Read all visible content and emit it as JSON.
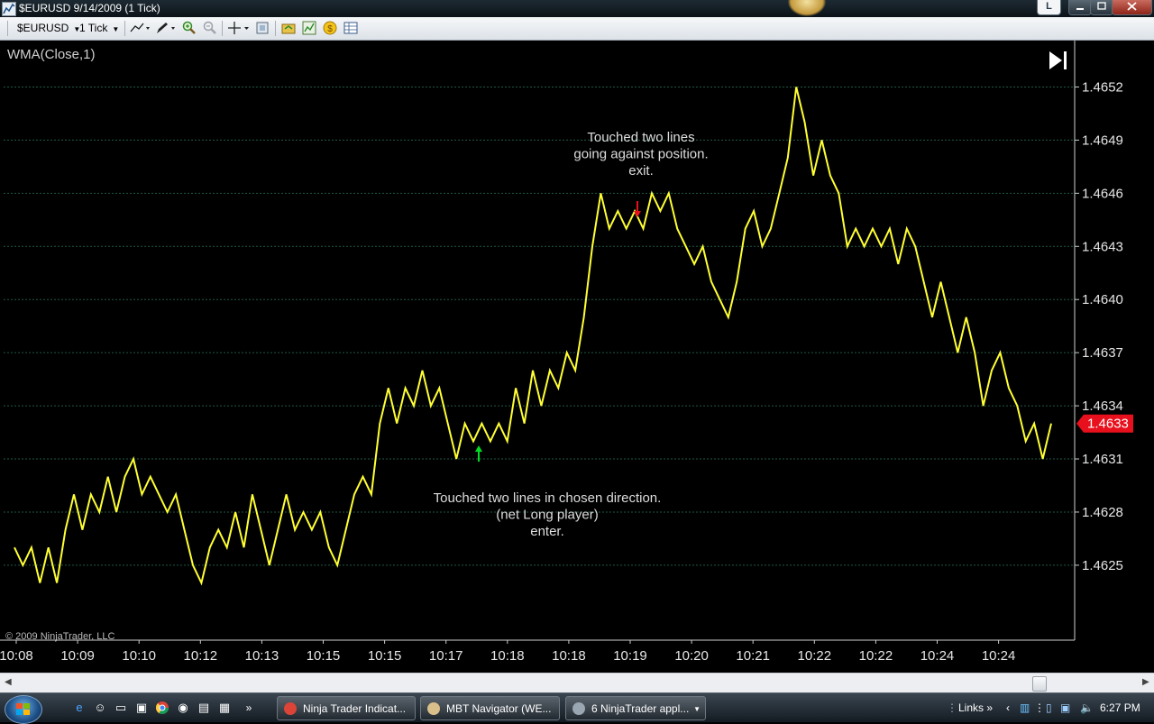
{
  "window": {
    "title": "$EURUSD  9/14/2009 (1 Tick)",
    "lang_button": "L"
  },
  "toolbar": {
    "instrument": "$EURUSD",
    "interval": "1 Tick"
  },
  "chart_data": {
    "type": "line",
    "indicator_label": "WMA(Close,1)",
    "copyright": "© 2009 NinjaTrader, LLC",
    "line_color": "#ffff33",
    "background": "#000000",
    "grid_color": "#1e5a44",
    "ylim": [
      1.46225,
      1.46535
    ],
    "yticks": [
      "1.4652",
      "1.4649",
      "1.4646",
      "1.4643",
      "1.4640",
      "1.4637",
      "1.4634",
      "1.4631",
      "1.4628",
      "1.4625"
    ],
    "xticks": [
      "10:08",
      "10:09",
      "10:10",
      "10:12",
      "10:13",
      "10:15",
      "10:15",
      "10:17",
      "10:18",
      "10:18",
      "10:19",
      "10:20",
      "10:21",
      "10:22",
      "10:22",
      "10:24",
      "10:24"
    ],
    "last_price": "1.4633",
    "last_price_color": "#e8101c",
    "points": [
      1.4626,
      1.4625,
      1.4626,
      1.4624,
      1.4626,
      1.4624,
      1.4627,
      1.4629,
      1.4627,
      1.4629,
      1.4628,
      1.463,
      1.4628,
      1.463,
      1.4631,
      1.4629,
      1.463,
      1.4629,
      1.4628,
      1.4629,
      1.4627,
      1.4625,
      1.4624,
      1.4626,
      1.4627,
      1.4626,
      1.4628,
      1.4626,
      1.4629,
      1.4627,
      1.4625,
      1.4627,
      1.4629,
      1.4627,
      1.4628,
      1.4627,
      1.4628,
      1.4626,
      1.4625,
      1.4627,
      1.4629,
      1.463,
      1.4629,
      1.4633,
      1.4635,
      1.4633,
      1.4635,
      1.4634,
      1.4636,
      1.4634,
      1.4635,
      1.4633,
      1.4631,
      1.4633,
      1.4632,
      1.4633,
      1.4632,
      1.4633,
      1.4632,
      1.4635,
      1.4633,
      1.4636,
      1.4634,
      1.4636,
      1.4635,
      1.4637,
      1.4636,
      1.4639,
      1.4643,
      1.4646,
      1.4644,
      1.4645,
      1.4644,
      1.4645,
      1.4644,
      1.4646,
      1.4645,
      1.4646,
      1.4644,
      1.4643,
      1.4642,
      1.4643,
      1.4641,
      1.464,
      1.4639,
      1.4641,
      1.4644,
      1.4645,
      1.4643,
      1.4644,
      1.4646,
      1.4648,
      1.4652,
      1.465,
      1.4647,
      1.4649,
      1.4647,
      1.4646,
      1.4643,
      1.4644,
      1.4643,
      1.4644,
      1.4643,
      1.4644,
      1.4642,
      1.4644,
      1.4643,
      1.4641,
      1.4639,
      1.4641,
      1.4639,
      1.4637,
      1.4639,
      1.4637,
      1.4634,
      1.4636,
      1.4637,
      1.4635,
      1.4634,
      1.4632,
      1.4633,
      1.4631,
      1.4633
    ],
    "annotations": {
      "exit_text": [
        "Touched two lines",
        "going against position.",
        "exit."
      ],
      "enter_text": [
        "Touched two lines in chosen direction.",
        "(net Long player)",
        "enter."
      ],
      "up_arrow_color": "#00dd22",
      "down_arrow_color": "#e8101c"
    }
  },
  "taskbar": {
    "tasks": [
      "Ninja Trader Indicat...",
      "MBT Navigator (WE...",
      "6 NinjaTrader appl..."
    ],
    "links_label": "Links",
    "clock": "6:27 PM"
  }
}
